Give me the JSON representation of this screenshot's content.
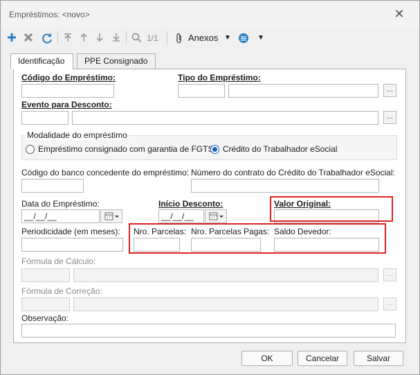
{
  "window": {
    "title": "Empréstimos: <novo>"
  },
  "toolbar": {
    "page_indicator": "1/1",
    "attachments_label": "Anexos",
    "icons": [
      "plus-icon",
      "delete-x-icon",
      "refresh-icon",
      "first-icon",
      "up-icon",
      "down-icon",
      "last-icon",
      "search-icon",
      "paperclip-icon",
      "hamburger-icon"
    ]
  },
  "tabs": [
    {
      "label": "Identificação",
      "active": true
    },
    {
      "label": "PPE Consignado",
      "active": false
    }
  ],
  "form": {
    "codigo_label": "Código do Empréstimo:",
    "tipo_label": "Tipo do Empréstimo:",
    "evento_label": "Evento para Desconto:",
    "modalidade_label": "Modalidade do empréstimo",
    "radio_fgts_label": "Empréstimo consignado com garantia de FGTS",
    "radio_credito_label": "Crédito do Trabalhador eSocial",
    "banco_label": "Código do banco concedente do empréstimo:",
    "contrato_label": "Número do contrato do Crédito do Trabalhador eSocial:",
    "data_label": "Data do Empréstimo:",
    "data_value": "__/__/__",
    "inicio_label": "Início Desconto:",
    "inicio_value": "__/__/__",
    "valor_label": "Valor Original:",
    "periodicidade_label": "Periodicidade (em meses):",
    "parcelas_label": "Nro. Parcelas:",
    "parcelas_pagas_label": "Nro. Parcelas Pagas:",
    "saldo_label": "Saldo Devedor:",
    "formula_calculo_label": "Fórmula de Cálculo:",
    "formula_correcao_label": "Fórmula de Correção:",
    "observacao_label": "Observação:",
    "ellipsis": "..."
  },
  "buttons": {
    "ok": "OK",
    "cancel": "Cancelar",
    "save": "Salvar"
  },
  "colors": {
    "highlight": "#e02020",
    "accent": "#1a5fb4",
    "toolbar_blue": "#2a7fc1"
  }
}
